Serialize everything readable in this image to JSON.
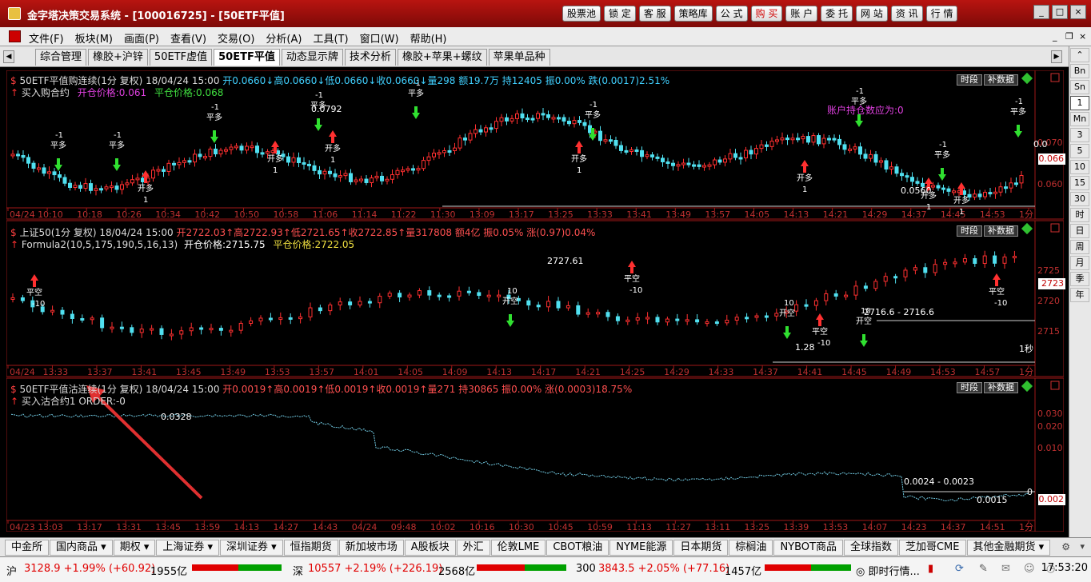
{
  "window": {
    "title": "金字塔决策交易系统 - [100016725] - [50ETF平值]",
    "buttons": [
      "股票池",
      "锁 定",
      "客 服",
      "策略库",
      "公 式",
      "购 买",
      "账 户",
      "委 托",
      "网 站",
      "资 讯",
      "行 情"
    ],
    "highlight_button": "购 买",
    "controls": [
      "_",
      "□",
      "×"
    ]
  },
  "menu": {
    "items": [
      "文件(F)",
      "板块(M)",
      "画面(P)",
      "查看(V)",
      "交易(O)",
      "分析(A)",
      "工具(T)",
      "窗口(W)",
      "帮助(H)"
    ],
    "mdi_controls": [
      "_",
      "❐",
      "×"
    ]
  },
  "tabs": {
    "items": [
      "综合管理",
      "橡胶+沪锌",
      "50ETF虚值",
      "50ETF平值",
      "动态显示牌",
      "技术分析",
      "橡胶+苹果+螺纹",
      "苹果单品种"
    ],
    "active": "50ETF平值"
  },
  "panels": [
    {
      "header": "50ETF平值购连续(1分 复权) 18/04/24 15:00",
      "header_quote": "开0.0660↓高0.0660↓低0.0660↓收0.0660↓量298 额19.7万 持12405 振0.00% 跌(0.0017)2.51%",
      "line2": "买入购合约",
      "line2_a": "开仓价格:0.061",
      "line2_b": "平仓价格:0.068",
      "btns": [
        "时段",
        "补数据"
      ],
      "axis_right": [
        "0.070",
        "0.060"
      ],
      "price_tag": "0.066",
      "time_labels": [
        "04/24",
        "10:10",
        "10:18",
        "10:26",
        "10:34",
        "10:42",
        "10:50",
        "10:58",
        "11:06",
        "11:14",
        "11:22",
        "11:30",
        "13:09",
        "13:17",
        "13:25",
        "13:33",
        "13:41",
        "13:49",
        "13:57",
        "14:05",
        "14:13",
        "14:21",
        "14:29",
        "14:37",
        "14:45",
        "14:53",
        "1分"
      ],
      "annotations": {
        "peak": "0.0792",
        "low": "0.0560",
        "account": "账户持仓数应为:0",
        "right_val": "0.0"
      }
    },
    {
      "header": "上证50(1分 复权) 18/04/24 15:00",
      "header_quote": "开2722.03↑高2722.93↑低2721.65↑收2722.85↑量317808 额4亿 振0.05% 涨(0.97)0.04%",
      "line2": "Formula2(10,5,175,190,5,16,13)",
      "line2_a": "开仓价格:2715.75",
      "line2_b": "平仓价格:2722.05",
      "btns": [
        "时段",
        "补数据"
      ],
      "axis_right": [
        "2725",
        "2720",
        "2715"
      ],
      "price_tag": "2723",
      "time_labels": [
        "04/24",
        "13:33",
        "13:37",
        "13:41",
        "13:45",
        "13:49",
        "13:53",
        "13:57",
        "14:01",
        "14:05",
        "14:09",
        "14:13",
        "14:17",
        "14:21",
        "14:25",
        "14:29",
        "14:33",
        "14:37",
        "14:41",
        "14:45",
        "14:49",
        "14:53",
        "14:57",
        "1分"
      ],
      "annotations": {
        "peak": "2727.61",
        "range": "2716.6 - 2716.6",
        "low": "1.28",
        "period": "1秒"
      }
    },
    {
      "header": "50ETF平值沽连续(1分 复权) 18/04/24 15:00",
      "header_quote": "开0.0019↑高0.0019↑低0.0019↑收0.0019↑量271 持30865 振0.00% 涨(0.0003)18.75%",
      "line2": "买入沽合约1 ORDER:-0",
      "btns": [
        "时段",
        "补数据"
      ],
      "axis_right": [
        "0.030",
        "0.020",
        "0.010"
      ],
      "price_tag": "0.002",
      "time_labels": [
        "04/23",
        "13:03",
        "13:17",
        "13:31",
        "13:45",
        "13:59",
        "14:13",
        "14:27",
        "14:43",
        "04/24",
        "09:48",
        "10:02",
        "10:16",
        "10:30",
        "10:45",
        "10:59",
        "11:13",
        "11:27",
        "13:11",
        "13:25",
        "13:39",
        "13:53",
        "14:07",
        "14:23",
        "14:37",
        "14:51",
        "1分"
      ],
      "annotations": {
        "peak": "0.0328",
        "range": "0.0024 - 0.0023",
        "low": "0.0015",
        "right_val": "0"
      }
    }
  ],
  "chart_marks": {
    "open_long": "开多",
    "close_long": "平多",
    "open_short": "开空",
    "close_short": "平空",
    "qty_pos": "1",
    "qty_neg": "-1",
    "qty_pos10": "10",
    "qty_neg10": "-10"
  },
  "right_toolbar": [
    "Bn",
    "Sn",
    "1",
    "Mn",
    "3",
    "5",
    "10",
    "15",
    "30",
    "时",
    "日",
    "周",
    "月",
    "季",
    "年"
  ],
  "right_toolbar_active": "1",
  "bottom_tabs": [
    "中金所",
    "国内商品 ▾",
    "期权 ▾",
    "上海证券 ▾",
    "深圳证券 ▾",
    "恒指期货",
    "新加坡市场",
    "A股板块",
    "外汇",
    "伦敦LME",
    "CBOT粮油",
    "NYME能源",
    "日本期货",
    "棕榈油",
    "NYBOT商品",
    "全球指数",
    "芝加哥CME",
    "其他金融期货 ▾"
  ],
  "status": {
    "sh": "沪",
    "sh_val": "3128.9 +1.99% (+60.92)",
    "sh_amt": "1955亿",
    "sz": "深",
    "sz_val": "10557 +2.19% (+226.19)",
    "sz_amt": "2568亿",
    "hs300": "300",
    "hs300_val": "3843.5 +2.05% (+77.16)",
    "hs300_amt": "1457亿",
    "news": "即时行情...",
    "time": "17:53:20"
  },
  "colors": {
    "up": "#ff3030",
    "down": "#50e0f0",
    "axis": "#c02020",
    "header_up": "#ff4040",
    "header_down": "#40e040",
    "accent": "#b81410"
  }
}
